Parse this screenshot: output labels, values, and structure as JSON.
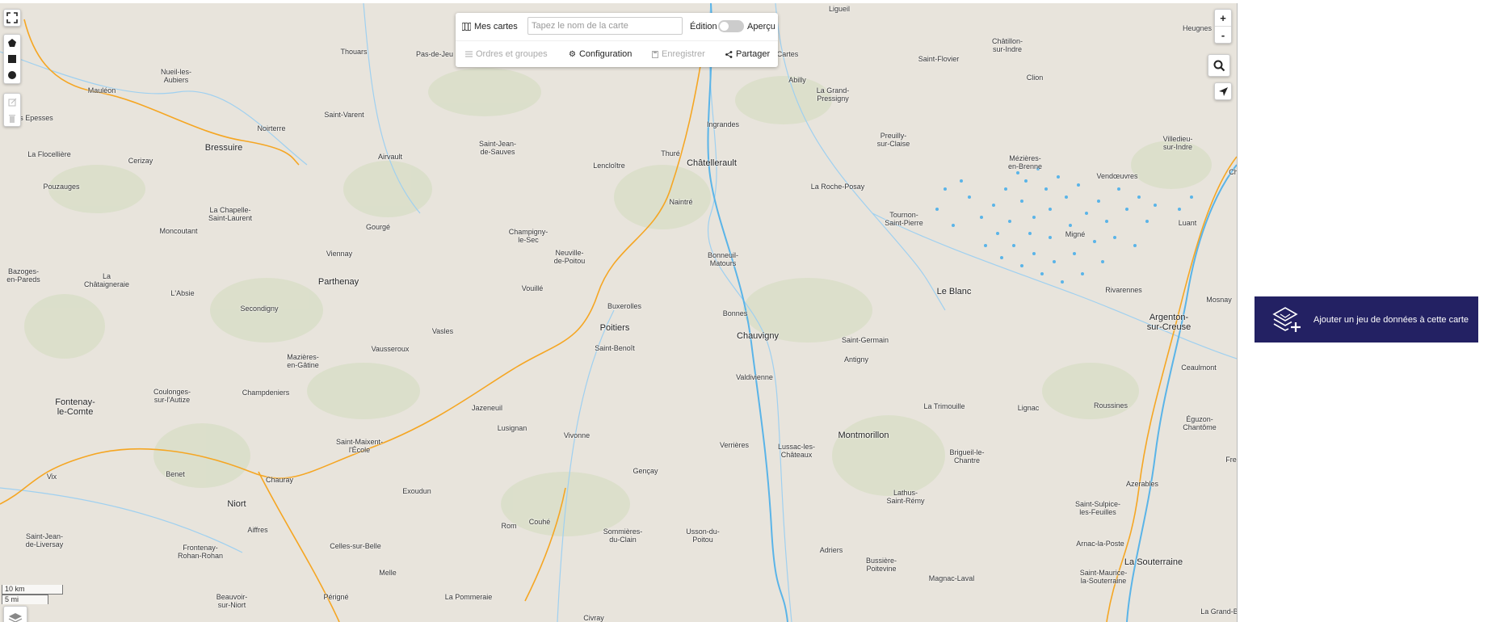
{
  "toolbar": {
    "my_maps": "Mes cartes",
    "name_placeholder": "Tapez le nom de la carte",
    "edition": "Édition",
    "preview": "Aperçu",
    "orders_groups": "Ordres et groupes",
    "configuration": "Configuration",
    "save": "Enregistrer",
    "share": "Partager"
  },
  "zoom": {
    "in": "+",
    "out": "-"
  },
  "scale": {
    "km": "10 km",
    "mi": "5 mi"
  },
  "panel": {
    "add_dataset": "Ajouter un jeu de données à cette carte"
  },
  "colors": {
    "panel_button": "#232163",
    "water": "#5ab4e8",
    "motorway": "#f5a623"
  },
  "places": [
    {
      "name": "Ligueil",
      "big": false
    },
    {
      "name": "Heugnes",
      "big": false
    },
    {
      "name": "Châtillon-\nsur-Indre",
      "big": false
    },
    {
      "name": "Saint-Flovier",
      "big": false
    },
    {
      "name": "Clion",
      "big": false
    },
    {
      "name": "Thouars",
      "big": false
    },
    {
      "name": "Pas-de-Jeu",
      "big": false
    },
    {
      "name": "Nueil-les-\nAubiers",
      "big": false
    },
    {
      "name": "Mauléon",
      "big": false
    },
    {
      "name": "Les Epesses",
      "big": false
    },
    {
      "name": "La Flocellière",
      "big": false
    },
    {
      "name": "Pouzauges",
      "big": false
    },
    {
      "name": "Cerizay",
      "big": false
    },
    {
      "name": "Bressuire",
      "big": true
    },
    {
      "name": "Noirterre",
      "big": false
    },
    {
      "name": "Saint-Varent",
      "big": false
    },
    {
      "name": "Airvault",
      "big": false
    },
    {
      "name": "Saint-Jean-\nde-Sauves",
      "big": false
    },
    {
      "name": "Lencloître",
      "big": false
    },
    {
      "name": "Thuré",
      "big": false
    },
    {
      "name": "Ingrandes",
      "big": false
    },
    {
      "name": "Châtellerault",
      "big": true
    },
    {
      "name": "Abilly",
      "big": false
    },
    {
      "name": "La Grand-\nPressigny",
      "big": false
    },
    {
      "name": "Preuilly-\nsur-Claise",
      "big": false
    },
    {
      "name": "Mézières-\nen-Brenne",
      "big": false
    },
    {
      "name": "Vendœuvres",
      "big": false
    },
    {
      "name": "Villedieu-\nsur-Indre",
      "big": false
    },
    {
      "name": "La Roche-Posay",
      "big": false
    },
    {
      "name": "Naintré",
      "big": false
    },
    {
      "name": "Tournon-\nSaint-Pierre",
      "big": false
    },
    {
      "name": "Migné",
      "big": false
    },
    {
      "name": "Luant",
      "big": false
    },
    {
      "name": "La Chapelle-\nSaint-Laurent",
      "big": false
    },
    {
      "name": "Gourgé",
      "big": false
    },
    {
      "name": "Moncoutant",
      "big": false
    },
    {
      "name": "Champigny-\nle-Sec",
      "big": false
    },
    {
      "name": "Neuville-\nde-Poitou",
      "big": false
    },
    {
      "name": "Bonneuil-\nMatours",
      "big": false
    },
    {
      "name": "Viennay",
      "big": false
    },
    {
      "name": "Bazoges-\nen-Pareds",
      "big": false
    },
    {
      "name": "La\nChâtaigneraie",
      "big": false
    },
    {
      "name": "Parthenay",
      "big": true
    },
    {
      "name": "Vouillé",
      "big": false
    },
    {
      "name": "L'Absie",
      "big": false
    },
    {
      "name": "Le Blanc",
      "big": true
    },
    {
      "name": "Rivarennes",
      "big": false
    },
    {
      "name": "Secondigny",
      "big": false
    },
    {
      "name": "Buxerolles",
      "big": false
    },
    {
      "name": "Bonnes",
      "big": false
    },
    {
      "name": "Mosnay",
      "big": false
    },
    {
      "name": "Argenton-\nsur-Creuse",
      "big": true
    },
    {
      "name": "Poitiers",
      "big": true
    },
    {
      "name": "Chauvigny",
      "big": true
    },
    {
      "name": "Vasles",
      "big": false
    },
    {
      "name": "Saint-Germain",
      "big": false
    },
    {
      "name": "Vausseroux",
      "big": false
    },
    {
      "name": "Saint-Benoît",
      "big": false
    },
    {
      "name": "Mazières-\nen-Gâtine",
      "big": false
    },
    {
      "name": "Antigny",
      "big": false
    },
    {
      "name": "Ceaulmont",
      "big": false
    },
    {
      "name": "Valdivienne",
      "big": false
    },
    {
      "name": "Champdeniers",
      "big": false
    },
    {
      "name": "Coulonges-\nsur-l'Autize",
      "big": false
    },
    {
      "name": "Fontenay-\nle-Comte",
      "big": true
    },
    {
      "name": "Jazeneuil",
      "big": false
    },
    {
      "name": "La Trimouille",
      "big": false
    },
    {
      "name": "Lignac",
      "big": false
    },
    {
      "name": "Roussines",
      "big": false
    },
    {
      "name": "Éguzon-\nChantôme",
      "big": false
    },
    {
      "name": "Lusignan",
      "big": false
    },
    {
      "name": "Vivonne",
      "big": false
    },
    {
      "name": "Montmorillon",
      "big": true
    },
    {
      "name": "Saint-Maixent-\nl'École",
      "big": false
    },
    {
      "name": "Verrières",
      "big": false
    },
    {
      "name": "Lussac-les-\nChâteaux",
      "big": false
    },
    {
      "name": "Brigueil-le-\nChantre",
      "big": false
    },
    {
      "name": "Vix",
      "big": false
    },
    {
      "name": "Benet",
      "big": false
    },
    {
      "name": "Chauray",
      "big": false
    },
    {
      "name": "Gençay",
      "big": false
    },
    {
      "name": "Azerables",
      "big": false
    },
    {
      "name": "Exoudun",
      "big": false
    },
    {
      "name": "Lathus-\nSaint-Rémy",
      "big": false
    },
    {
      "name": "Niort",
      "big": true
    },
    {
      "name": "Couhé",
      "big": false
    },
    {
      "name": "Saint-Sulpice-\nles-Feuilles",
      "big": false
    },
    {
      "name": "Aiffres",
      "big": false
    },
    {
      "name": "Rom",
      "big": false
    },
    {
      "name": "Sommières-\ndu-Clain",
      "big": false
    },
    {
      "name": "Usson-du-\nPoitou",
      "big": false
    },
    {
      "name": "Saint-Jean-\nde-Liversay",
      "big": false
    },
    {
      "name": "Frontenay-\nRohan-Rohan",
      "big": false
    },
    {
      "name": "Celles-sur-Belle",
      "big": false
    },
    {
      "name": "Adriers",
      "big": false
    },
    {
      "name": "Arnac-la-Poste",
      "big": false
    },
    {
      "name": "Bussière-\nPoitevine",
      "big": false
    },
    {
      "name": "La Souterraine",
      "big": true
    },
    {
      "name": "Melle",
      "big": false
    },
    {
      "name": "Magnac-Laval",
      "big": false
    },
    {
      "name": "Saint-Maurice-\nla-Souterraine",
      "big": false
    },
    {
      "name": "Beauvoir-\nsur-Niort",
      "big": false
    },
    {
      "name": "Périgné",
      "big": false
    },
    {
      "name": "La Pommeraie",
      "big": false
    },
    {
      "name": "Civray",
      "big": false
    },
    {
      "name": "La Grand-Bo",
      "big": false
    },
    {
      "name": "Cartes",
      "big": false
    },
    {
      "name": "Ch",
      "big": false
    },
    {
      "name": "Fre",
      "big": false
    }
  ]
}
